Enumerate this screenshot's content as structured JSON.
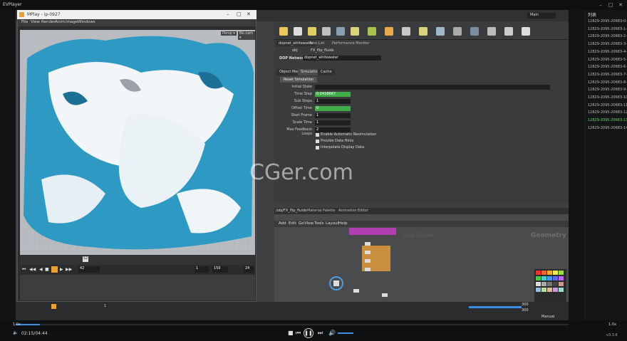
{
  "player": {
    "title": "EVPlayer",
    "elapsed": "02:15/04:44",
    "speed_left": "1.0x",
    "speed_right": "1.0x",
    "version": "v3.3.6",
    "watermark": "CGer.com",
    "playlist_header": "列表",
    "playlist": [
      "12829-2095-20683-0-W",
      "12829-2095-20683-1-Gr",
      "12829-2095-20683-2-D",
      "12829-2095-20683-3-Fl",
      "12829-2095-20683-4-S",
      "12829-2095-20683-5-R",
      "12829-2095-20683-6-Sc",
      "12829-2095-20683-7-S",
      "12829-2095-20683-8-Sp",
      "12829-2095-20683-9-C",
      "12829-2095-20683-10-",
      "12829-2095-20683-11-",
      "12829-2095-20683-12-",
      "12829-2095-20683-13-",
      "12829-2095-20683-14-"
    ],
    "active_index": 13
  },
  "mplay": {
    "title": "MPlay - ip-0927",
    "menu": [
      "File",
      "View",
      "Render",
      "Anim",
      "Image",
      "Windows"
    ],
    "frame": "42",
    "range_start": "1",
    "range_end": "150",
    "fps": "24",
    "tick_current": "52"
  },
  "houdini": {
    "desktop": "Main",
    "tabs": [
      "dopnet_whitewater",
      "Take List",
      "Performance Monitor"
    ],
    "path": "obj",
    "node_path": "FX_flip_fluids",
    "network_label": "DOP Network",
    "network_name": "dopnet_whitewater",
    "param_tabs": [
      "Object Merge",
      "Simulation",
      "Cache"
    ],
    "reset_button": "Reset Simulation",
    "params": [
      {
        "label": "Initial State",
        "value": ""
      },
      {
        "label": "Time Step",
        "value": "0.0416667"
      },
      {
        "label": "Sub Steps",
        "value": "1"
      },
      {
        "label": "Offset Time",
        "value": "0"
      },
      {
        "label": "Start Frame",
        "value": "1"
      },
      {
        "label": "Scale Time",
        "value": "1"
      },
      {
        "label": "Max Feedback Loops",
        "value": "2"
      }
    ],
    "checkboxes": [
      "Enable Automatic Resimulation",
      "Provide Data Hints",
      "Interpolate Display Data"
    ],
    "net_tabs": [
      "/obj/FX_flip_fluids",
      "Material Palette",
      "Animation Editor"
    ],
    "net_menu": [
      "Add",
      "Edit",
      "Go",
      "View",
      "Tools",
      "Layout",
      "Help"
    ],
    "net_context": "Geometry",
    "net_subtitle": "Solo Solver",
    "timeline_end": "300",
    "timeline_end2": "300",
    "timeline_frame": "1",
    "auto_update": "Manual"
  }
}
